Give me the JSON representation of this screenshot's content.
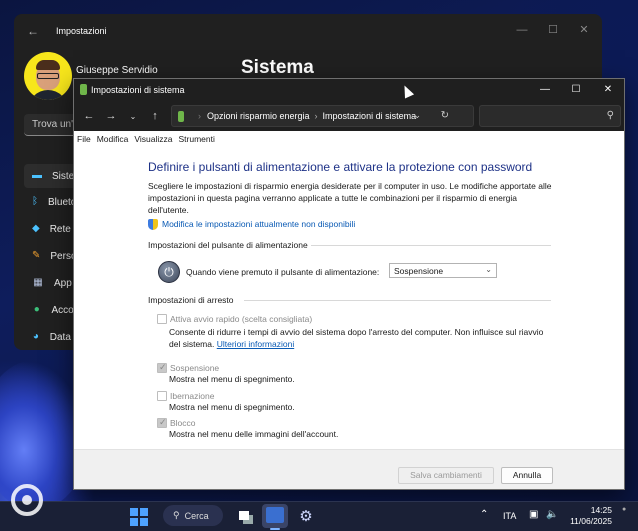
{
  "settings": {
    "title": "Impostazioni",
    "user_name": "Giuseppe Servidio",
    "page_title": "Sistema",
    "search_placeholder": "Trova un'i",
    "nav": [
      {
        "label": "Sistema",
        "icon": "monitor-icon",
        "selected": true
      },
      {
        "label": "Bluetooth e dispositivi",
        "icon": "bluetooth-icon"
      },
      {
        "label": "Rete e Internet",
        "icon": "wifi-icon"
      },
      {
        "label": "Personalizzazione",
        "icon": "brush-icon"
      },
      {
        "label": "App",
        "icon": "apps-icon"
      },
      {
        "label": "Account",
        "icon": "person-icon"
      },
      {
        "label": "Data e ora",
        "icon": "globe-clock-icon"
      }
    ],
    "accent": "#4cc2ff"
  },
  "cp": {
    "title": "Impostazioni di sistema",
    "breadcrumb": [
      "Opzioni risparmio energia",
      "Impostazioni di sistema"
    ],
    "menu": [
      "File",
      "Modifica",
      "Visualizza",
      "Strumenti"
    ],
    "heading": "Definire i pulsanti di alimentazione e attivare la protezione con password",
    "description": "Scegliere le impostazioni di risparmio energia desiderate per il computer in uso. Le modifiche apportate alle impostazioni in questa pagina verranno applicate a tutte le combinazioni per il risparmio di energia dell'utente.",
    "change_link": "Modifica le impostazioni attualmente non disponibili",
    "power_group": "Impostazioni del pulsante di alimentazione",
    "power_label": "Quando viene premuto il pulsante di alimentazione:",
    "power_value": "Sospensione",
    "shutdown_group": "Impostazioni di arresto",
    "options": [
      {
        "label": "Attiva avvio rapido (scelta consigliata)",
        "checked": false,
        "desc": "Consente di ridurre i tempi di avvio del sistema dopo l'arresto del computer. Non influisce sul riavvio del sistema.",
        "link": "Ulteriori informazioni"
      },
      {
        "label": "Sospensione",
        "checked": true,
        "desc": "Mostra nel menu di spegnimento."
      },
      {
        "label": "Ibernazione",
        "checked": false,
        "desc": "Mostra nel menu di spegnimento."
      },
      {
        "label": "Blocco",
        "checked": true,
        "desc": "Mostra nel menu delle immagini dell'account."
      }
    ],
    "save": "Salva cambiamenti",
    "cancel": "Annulla",
    "heading_color": "#1e3287",
    "link_color": "#0a5ab4"
  },
  "taskbar": {
    "search": "Cerca",
    "lang": "ITA",
    "time": "14:25",
    "date": "11/06/2025"
  }
}
